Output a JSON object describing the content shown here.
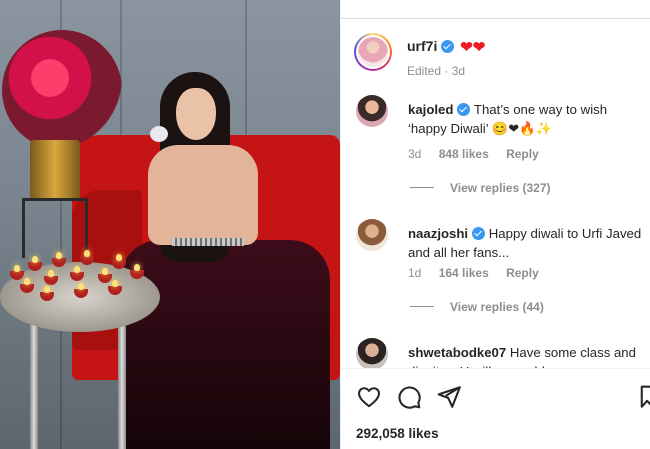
{
  "post": {
    "owner": {
      "username": "urf7i",
      "meta": "Edited · 3d",
      "hearts": "❤❤"
    },
    "comments": [
      {
        "username": "kajoled",
        "text": "That’s one way to wish ‘happy Diwali’",
        "emoji": "😊❤🔥✨",
        "age": "3d",
        "likes": "848 likes",
        "reply": "Reply",
        "view_replies": "View replies (327)"
      },
      {
        "username": "naazjoshi",
        "text": "Happy diwali to Urfi Javed and all her fans...",
        "age": "1d",
        "likes": "164 likes",
        "reply": "Reply",
        "view_replies": "View replies (44)"
      },
      {
        "username": "shwetabodke07",
        "text": "Have some class and dignity... U will grow old once"
      }
    ],
    "likes_count": "292,058 likes"
  },
  "icons": {
    "verified": "verified-badge-icon",
    "like": "heart-outline-icon",
    "comment": "comment-bubble-icon",
    "share": "paper-plane-icon",
    "save": "bookmark-icon"
  },
  "colors": {
    "verified": "#3897f0",
    "heart": "#ed1c24",
    "muted_text": "#8e8e8e",
    "text": "#262626"
  }
}
